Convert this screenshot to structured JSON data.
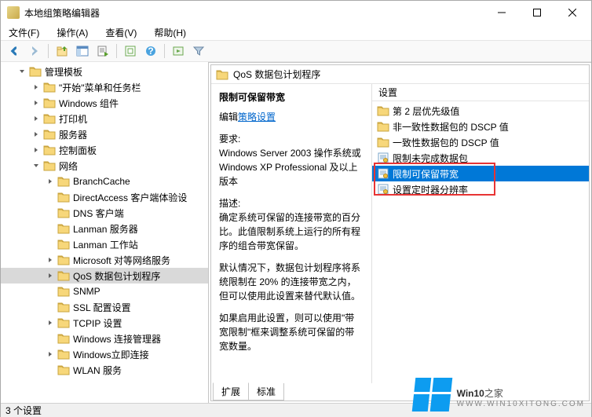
{
  "window": {
    "title": "本地组策略编辑器"
  },
  "menu": {
    "file": "文件(F)",
    "action": "操作(A)",
    "view": "查看(V)",
    "help": "帮助(H)"
  },
  "tree": {
    "root": "管理模板",
    "items": [
      "\"开始\"菜单和任务栏",
      "Windows 组件",
      "打印机",
      "服务器",
      "控制面板"
    ],
    "network": "网络",
    "net_items": [
      "BranchCache",
      "DirectAccess 客户端体验设",
      "DNS 客户端",
      "Lanman 服务器",
      "Lanman 工作站",
      "Microsoft 对等网络服务",
      "QoS 数据包计划程序",
      "SNMP",
      "SSL 配置设置",
      "TCPIP 设置",
      "Windows 连接管理器",
      "Windows立即连接",
      "WLAN 服务"
    ]
  },
  "panel": {
    "title": "QoS 数据包计划程序",
    "setting_title": "限制可保留带宽",
    "edit_prefix": "编辑",
    "edit_link": "策略设置",
    "req_label": "要求:",
    "req_text": "Windows Server 2003 操作系统或 Windows XP Professional 及以上版本",
    "desc_label": "描述:",
    "desc1": "确定系统可保留的连接带宽的百分比。此值限制系统上运行的所有程序的组合带宽保留。",
    "desc2": "默认情况下，数据包计划程序将系统限制在 20% 的连接带宽之内，但可以使用此设置来替代默认值。",
    "desc3": "如果启用此设置，则可以使用\"带宽限制\"框来调整系统可保留的带宽数量。"
  },
  "settings": {
    "header": "设置",
    "items": [
      "第 2 层优先级值",
      "非一致性数据包的 DSCP 值",
      "一致性数据包的 DSCP 值",
      "限制未完成数据包",
      "限制可保留带宽",
      "设置定时器分辨率"
    ]
  },
  "tabs": {
    "extended": "扩展",
    "standard": "标准"
  },
  "status": "3 个设置",
  "watermark": {
    "brand": "Win10",
    "suffix": "之家",
    "url": "WWW.WIN10XITONG.COM"
  }
}
